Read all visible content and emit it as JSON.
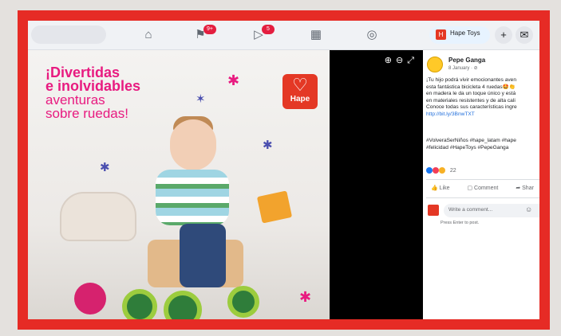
{
  "topbar": {
    "icons": [
      "home-icon",
      "flag-icon",
      "video-icon",
      "marketplace-icon",
      "groups-icon"
    ],
    "badges": {
      "flag": "9+",
      "video": "5"
    },
    "page_name": "Hape Toys",
    "page_logo_letter": "H",
    "add_icon": "+",
    "messenger_icon": "messenger-icon"
  },
  "photo": {
    "headline_bold": [
      "¡Divertidas",
      "e inolvidables"
    ],
    "headline_light": [
      "aventuras",
      "sobre ruedas!"
    ],
    "logo_text": "Hape",
    "logo_heart": "♡",
    "viewer_controls": "⊕⊖⤢"
  },
  "post": {
    "page_name": "Pepe Ganga",
    "date": "8 January · ⊘",
    "text_lines": [
      "¡Tu hijo podrá vivir emocionantes aven",
      "esta fantástica bicicleta 4 ruedas🤩👏",
      "en madera le da un toque único y está",
      "en materiales resistentes y de alta cali",
      "Conoce todas sus características ingre"
    ],
    "link": "http://bit.ly/3BnwTXT",
    "tags_lines": [
      "#VolveraSerNiños #hape_latam #hape",
      "#felicidad #HapeToys #PepeGanga"
    ],
    "reaction_count": "22",
    "actions": {
      "like": "Like",
      "comment": "Comment",
      "share": "Shar"
    },
    "comment_placeholder": "Write a comment...",
    "press_enter": "Press Enter to post."
  },
  "colors": {
    "border": "#e62b25",
    "brand_pink": "#e81b80",
    "hape_red": "#e43825",
    "facebook_blue": "#216fdb"
  }
}
